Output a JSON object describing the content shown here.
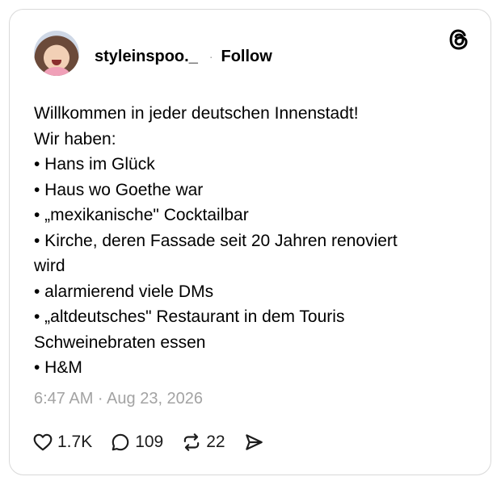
{
  "post": {
    "author": "styleinspoo._",
    "separator": "·",
    "follow_label": "Follow",
    "lines": [
      "Willkommen in jeder deutschen Innenstadt!",
      "Wir haben:",
      "• Hans im Glück",
      "• Haus wo Goethe war",
      "• „mexikanische\" Cocktailbar",
      "• Kirche, deren Fassade seit 20 Jahren renoviert",
      "wird",
      "• alarmierend viele DMs",
      "• „altdeutsches\" Restaurant in dem Touris",
      "Schweinebraten essen",
      "• H&M"
    ],
    "timestamp": "6:47 AM · Aug 23, 2026"
  },
  "actions": {
    "likes": "1.7K",
    "replies": "109",
    "reposts": "22"
  },
  "icons": {
    "logo": "threads-logo-icon",
    "like": "heart-icon",
    "reply": "comment-icon",
    "repost": "repost-icon",
    "share": "send-icon"
  }
}
